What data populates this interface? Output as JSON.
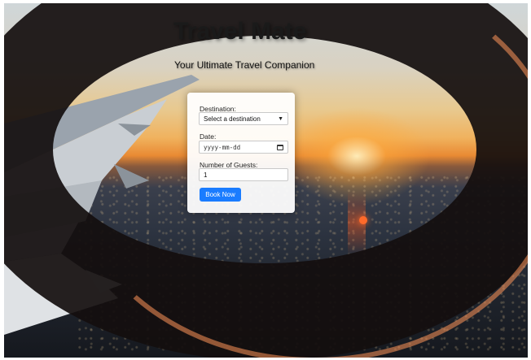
{
  "header": {
    "title": "Travel Mate",
    "subtitle": "Your Ultimate Travel Companion"
  },
  "form": {
    "destination_label": "Destination:",
    "destination_value": "Select a destination",
    "date_label": "Date:",
    "date_placeholder": "yyyy-mm-dd",
    "guests_label": "Number of Guests:",
    "guests_value": "1",
    "submit_label": "Book Now"
  },
  "colors": {
    "button": "#1a7cff",
    "card": "#ffffff"
  },
  "icons": {
    "destination_dropdown": "chevron-down-icon",
    "date_picker": "calendar-icon"
  }
}
